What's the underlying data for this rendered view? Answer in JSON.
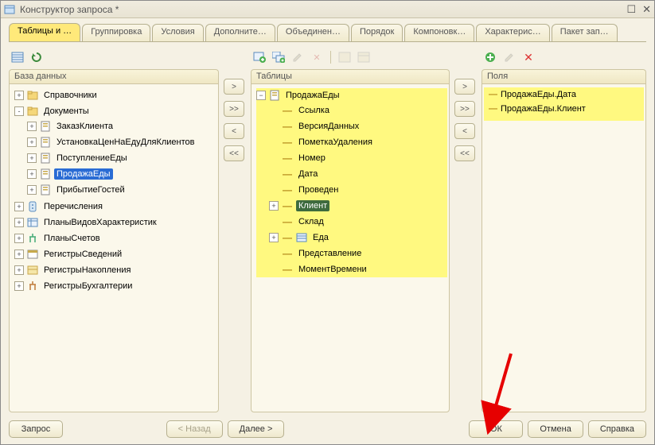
{
  "window": {
    "title": "Конструктор запроса *"
  },
  "tabs": [
    {
      "label": "Таблицы и …",
      "active": true
    },
    {
      "label": "Группировка"
    },
    {
      "label": "Условия"
    },
    {
      "label": "Дополните…"
    },
    {
      "label": "Объединен…"
    },
    {
      "label": "Порядок"
    },
    {
      "label": "Компоновк…"
    },
    {
      "label": "Характерис…"
    },
    {
      "label": "Пакет зап…"
    }
  ],
  "panels": {
    "db": {
      "title": "База данных"
    },
    "tables": {
      "title": "Таблицы"
    },
    "fields": {
      "title": "Поля"
    }
  },
  "db_tree": {
    "items": [
      {
        "exp": "+",
        "icon": "folder",
        "label": "Справочники"
      },
      {
        "exp": "-",
        "icon": "folder",
        "label": "Документы",
        "children": [
          {
            "exp": "+",
            "icon": "doc",
            "label": "ЗаказКлиента"
          },
          {
            "exp": "+",
            "icon": "doc",
            "label": "УстановкаЦенНаЕдуДляКлиентов"
          },
          {
            "exp": "+",
            "icon": "doc",
            "label": "ПоступлениеЕды"
          },
          {
            "exp": "+",
            "icon": "doc",
            "label": "ПродажаЕды",
            "selected": true
          },
          {
            "exp": "+",
            "icon": "doc",
            "label": "ПрибытиеГостей"
          }
        ]
      },
      {
        "exp": "+",
        "icon": "enum",
        "label": "Перечисления"
      },
      {
        "exp": "+",
        "icon": "plan",
        "label": "ПланыВидовХарактеристик"
      },
      {
        "exp": "+",
        "icon": "accplan",
        "label": "ПланыСчетов"
      },
      {
        "exp": "+",
        "icon": "reg",
        "label": "РегистрыСведений"
      },
      {
        "exp": "+",
        "icon": "regacc",
        "label": "РегистрыНакопления"
      },
      {
        "exp": "+",
        "icon": "regbuh",
        "label": "РегистрыБухгалтерии"
      }
    ]
  },
  "tables_tree": {
    "root": {
      "exp": "-",
      "label": "ПродажаЕды",
      "icon": "doc",
      "children": [
        {
          "label": "Ссылка"
        },
        {
          "label": "ВерсияДанных"
        },
        {
          "label": "ПометкаУдаления"
        },
        {
          "label": "Номер"
        },
        {
          "label": "Дата"
        },
        {
          "label": "Проведен"
        },
        {
          "exp": "+",
          "label": "Клиент",
          "hl": true
        },
        {
          "label": "Склад"
        },
        {
          "exp": "+",
          "icon": "table",
          "label": "Еда"
        },
        {
          "label": "Представление"
        },
        {
          "label": "МоментВремени"
        }
      ]
    }
  },
  "fields": [
    {
      "label": "ПродажаЕды.Дата"
    },
    {
      "label": "ПродажаЕды.Клиент"
    }
  ],
  "footer": {
    "query": "Запрос",
    "back": "< Назад",
    "next": "Далее >",
    "ok": "ОК",
    "cancel": "Отмена",
    "help": "Справка"
  }
}
